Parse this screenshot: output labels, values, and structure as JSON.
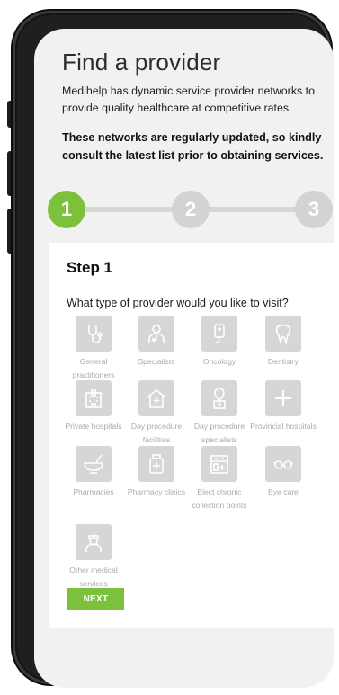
{
  "page": {
    "title": "Find a provider",
    "intro": "Medihelp has dynamic service provider networks to provide quality healthcare at competitive rates.",
    "notice": "These networks are regularly updated, so kindly consult the latest list prior to obtaining services."
  },
  "stepper": {
    "steps": [
      {
        "label": "1",
        "state": "active"
      },
      {
        "label": "2",
        "state": "inactive"
      },
      {
        "label": "3",
        "state": "inactive"
      }
    ],
    "active_color": "#7cc13b",
    "inactive_color": "#d3d3d3"
  },
  "card": {
    "heading": "Step 1",
    "question": "What type of provider would you like to visit?",
    "providers": [
      {
        "label": "General practitioners",
        "icon": "stethoscope-icon"
      },
      {
        "label": "Specialists",
        "icon": "doctor-icon"
      },
      {
        "label": "Oncology",
        "icon": "iv-drip-icon"
      },
      {
        "label": "Dentistry",
        "icon": "tooth-icon"
      },
      {
        "label": "Private hospitals",
        "icon": "hospital-building-icon"
      },
      {
        "label": "Day procedure facilities",
        "icon": "medical-house-icon"
      },
      {
        "label": "Day procedure specialists",
        "icon": "location-pin-clinic-icon"
      },
      {
        "label": "Provincial hospitals",
        "icon": "plus-icon"
      },
      {
        "label": "Pharmacies",
        "icon": "mortar-pestle-icon"
      },
      {
        "label": "Pharmacy clinics",
        "icon": "medicine-bottle-icon"
      },
      {
        "label": "Elect chronic collection points",
        "icon": "pharmacy-counter-icon"
      },
      {
        "label": "Eye care",
        "icon": "glasses-icon"
      },
      {
        "label": "Other medical services",
        "icon": "nurse-icon"
      }
    ],
    "next_label": "NEXT"
  },
  "colors": {
    "accent": "#7cc13b",
    "tile_bg": "#d6d6d6",
    "tile_label": "#aaaaaa"
  }
}
